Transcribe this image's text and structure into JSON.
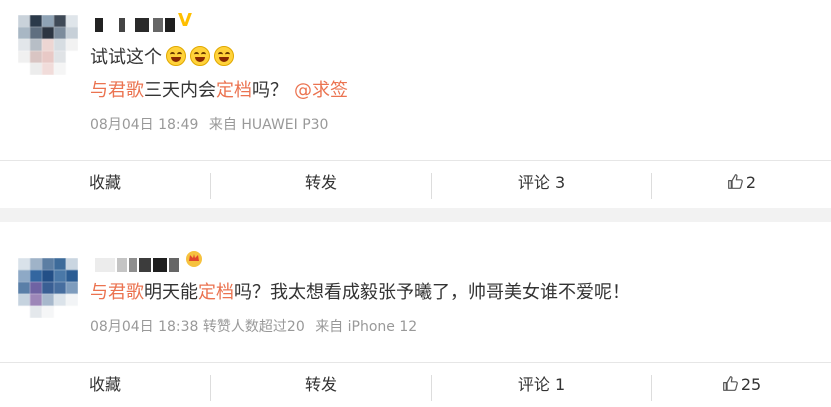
{
  "posts": [
    {
      "avatar_note": "pixelated",
      "text_line1": "试试这个",
      "mention_line": {
        "hashtag": "与君歌",
        "mid1": "三天内会",
        "keyword": "定档",
        "mid2": "吗？",
        "at": "@求签"
      },
      "meta": {
        "date": "08月04日",
        "time": "18:49",
        "source": "来自 HUAWEI P30"
      },
      "actions": {
        "collect": "收藏",
        "repost": "转发",
        "comment": "评论 3",
        "likes": "2"
      }
    },
    {
      "text": {
        "hashtag": "与君歌",
        "mid1": "明天能",
        "keyword": "定档",
        "rest": "吗？我太想看成毅张予曦了，帅哥美女谁不爱呢！"
      },
      "meta": {
        "date": "08月04日",
        "time": "18:38",
        "extra": "转赞人数超过20",
        "source": "来自 iPhone 12"
      },
      "actions": {
        "collect": "收藏",
        "repost": "转发",
        "comment": "评论 1",
        "likes": "25"
      }
    }
  ],
  "colors": {
    "highlight": "#eb7350",
    "meta": "#999999",
    "text": "#333333",
    "gap": "#f2f2f2",
    "verified": "#ffbf00"
  },
  "icons": [
    "verified-v-icon",
    "crown-icon",
    "grin-emoji-icon",
    "thumbs-up-icon"
  ]
}
